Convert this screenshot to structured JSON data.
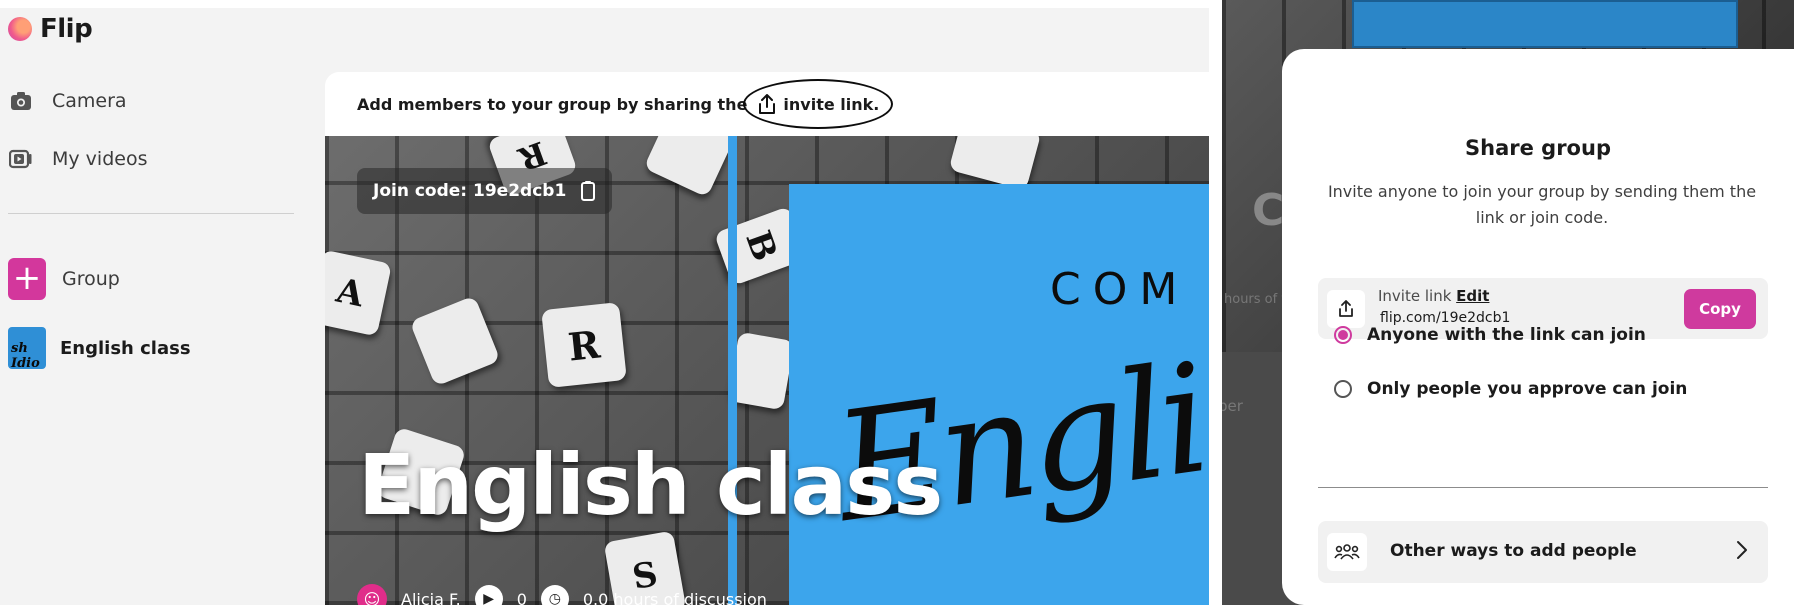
{
  "app": {
    "logo_text": "Flip",
    "sidebar": {
      "items": [
        {
          "label": "Camera",
          "icon": "camera-icon"
        },
        {
          "label": "My videos",
          "icon": "video-icon"
        }
      ],
      "group_button_label": "Group",
      "groups": [
        {
          "label": "English class",
          "thumb_text": "sh Idio"
        }
      ]
    },
    "card": {
      "header_text": "Add members to your group by sharing the",
      "invite_link_text": "invite link.",
      "join_code": "Join code: 19e2dcb1",
      "banner_title": "English class",
      "banner_com": "COM",
      "banner_script": "English",
      "owner_name": "Alicia F.",
      "video_count": "0",
      "discussion_text": "0.0 hours of discussion"
    }
  },
  "right_bg": {
    "ghost_hours": "hours of t",
    "ghost_ber": "ber",
    "ghost_c": "C"
  },
  "dialog": {
    "title": "Share group",
    "description": "Invite anyone to join your group by sending them the link or join code.",
    "invite_label": "Invite link",
    "edit_label": "Edit",
    "invite_url": "flip.com/19e2dcb1",
    "copy_label": "Copy",
    "options": [
      {
        "label": "Anyone with the link can join",
        "selected": true
      },
      {
        "label": "Only people you approve can join",
        "selected": false
      }
    ],
    "other_ways_label": "Other ways to add people"
  },
  "colors": {
    "accent_pink": "#cf3a9e",
    "banner_blue": "#3ca5ec"
  }
}
